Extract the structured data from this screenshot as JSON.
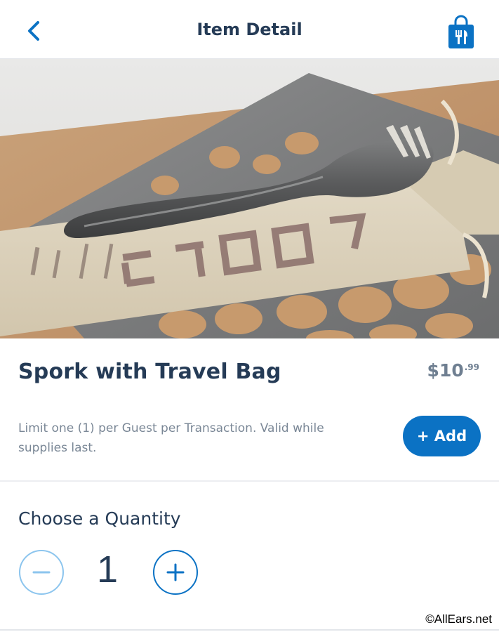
{
  "header": {
    "title": "Item Detail",
    "back_icon": "chevron-left-icon",
    "bag_icon": "shopping-bag-utensils-icon"
  },
  "product": {
    "name": "Spork with Travel Bag",
    "price_currency": "$",
    "price_dollars": "10",
    "price_cents": ".99",
    "description": "Limit one (1) per Guest per Transaction. Valid while supplies last.",
    "add_label": "+ Add",
    "image_alt": "Metal spork resting on a canvas travel bag"
  },
  "quantity": {
    "label": "Choose a Quantity",
    "value": "1",
    "minus_icon": "minus-circle-icon",
    "plus_icon": "plus-circle-icon"
  },
  "watermark": "©AllEars.net",
  "colors": {
    "accent": "#0b72c4",
    "text_dark": "#253b56",
    "text_muted": "#7a8796",
    "price": "#6f7f91",
    "minus_border": "#8cc5ee"
  }
}
